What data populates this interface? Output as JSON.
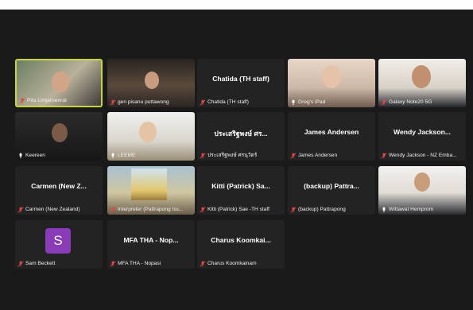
{
  "app": {
    "title_fragment": ""
  },
  "colors": {
    "background": "#1a1a1a",
    "tile": "#232323",
    "active_speaker_border": "#c8d631",
    "mute_icon": "#e04848",
    "avatar_s": "#8a3bb8"
  },
  "participants": [
    {
      "name": "Pita Limjaroenrat",
      "display": "",
      "muted": true,
      "active": true,
      "has_video": true,
      "icon": "mute-icon"
    },
    {
      "name": "gen pisanu puttawong",
      "display": "",
      "muted": true,
      "active": false,
      "has_video": true
    },
    {
      "name": "Chatida (TH staff)",
      "display": "Chatida (TH staff)",
      "muted": true,
      "active": false,
      "has_video": false
    },
    {
      "name": "Greg's iPad",
      "display": "",
      "muted": false,
      "active": false,
      "has_video": true
    },
    {
      "name": "Galaxy Note20 5G",
      "display": "",
      "muted": true,
      "active": false,
      "has_video": true
    },
    {
      "name": "Keereen",
      "display": "",
      "muted": false,
      "active": false,
      "has_video": true
    },
    {
      "name": "LEEME",
      "display": "",
      "muted": false,
      "active": false,
      "has_video": true
    },
    {
      "name": "ประเสริฐพงษ์ ศรนุวัตร์",
      "display": "ประเสริฐพงษ์ ศร...",
      "muted": true,
      "active": false,
      "has_video": false
    },
    {
      "name": "James Andersen",
      "display": "James Andersen",
      "muted": true,
      "active": false,
      "has_video": false
    },
    {
      "name": "Wendy Jackson - NZ Emba...",
      "display": "Wendy Jackson...",
      "muted": true,
      "active": false,
      "has_video": false
    },
    {
      "name": "Carmen (New Zealand)",
      "display": "Carmen (New Z...",
      "muted": true,
      "active": false,
      "has_video": false
    },
    {
      "name": "Interpreter (Pattrapong Iss...",
      "display": "",
      "muted": true,
      "active": false,
      "has_video": true
    },
    {
      "name": "Kitti (Patrick) Sae -TH staff",
      "display": "Kitti (Patrick) Sa...",
      "muted": true,
      "active": false,
      "has_video": false
    },
    {
      "name": "(backup) Pattrapong",
      "display": "(backup) Pattra...",
      "muted": true,
      "active": false,
      "has_video": false
    },
    {
      "name": "Wittawat Hemprom",
      "display": "",
      "muted": false,
      "active": false,
      "has_video": true
    },
    {
      "name": "Sam Beckett",
      "display": "S",
      "muted": true,
      "active": false,
      "has_video": false,
      "avatar": true
    },
    {
      "name": "MFA THA - Nopasi",
      "display": "MFA THA - Nop...",
      "muted": true,
      "active": false,
      "has_video": false
    },
    {
      "name": "Charus Koomkainam",
      "display": "Charus Koomkai...",
      "muted": true,
      "active": false,
      "has_video": false
    }
  ]
}
